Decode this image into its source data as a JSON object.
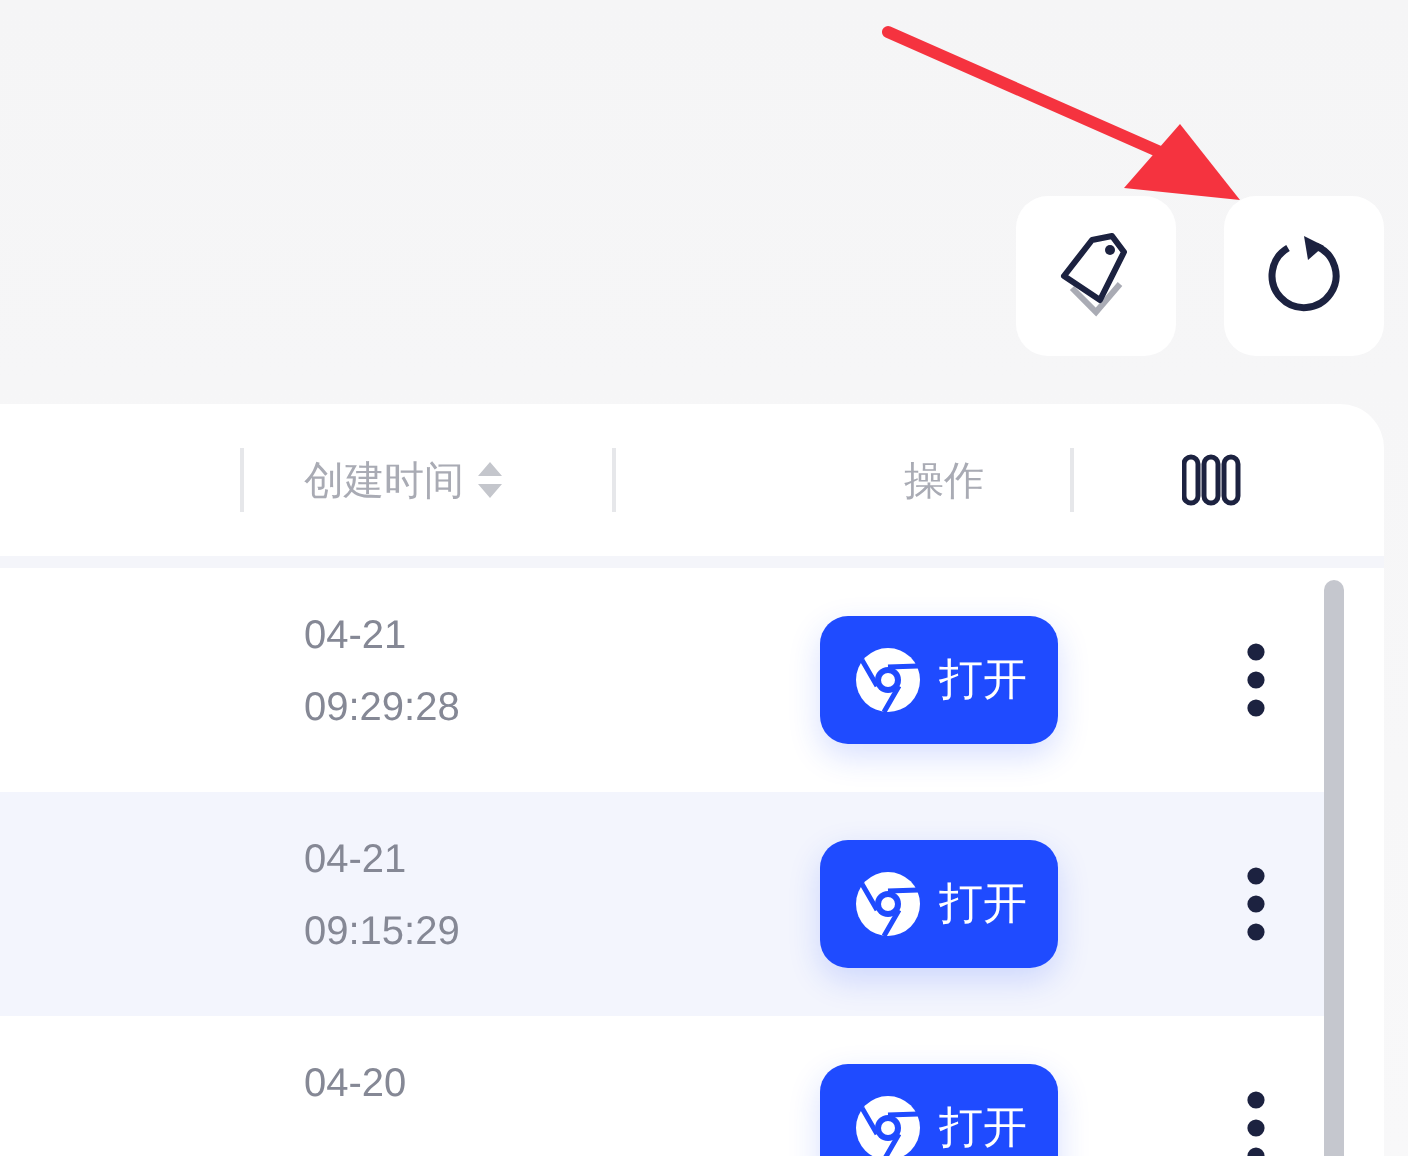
{
  "toolbar": {
    "buttons": [
      {
        "kind": "tag"
      },
      {
        "kind": "refresh"
      }
    ]
  },
  "annotation_arrow": true,
  "table": {
    "columns": [
      {
        "label": "创建时间",
        "sortable": true
      },
      {
        "label": "操作",
        "sortable": false
      }
    ],
    "rows": [
      {
        "date": "04-21",
        "time": "09:29:28",
        "action": "打开"
      },
      {
        "date": "04-21",
        "time": "09:15:29",
        "action": "打开"
      },
      {
        "date": "04-20",
        "action": "打开"
      }
    ]
  }
}
